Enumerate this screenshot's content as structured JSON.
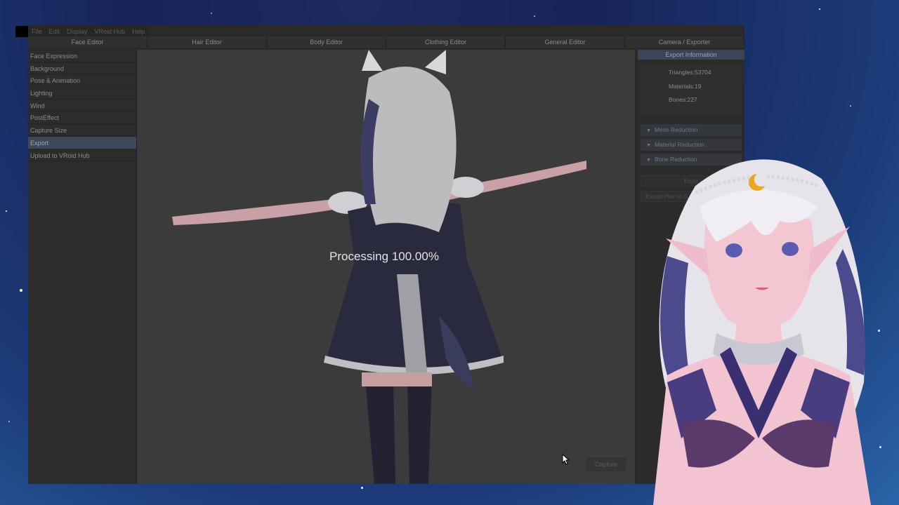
{
  "menu": [
    "File",
    "Edit",
    "Display",
    "VRoid Hub",
    "Help"
  ],
  "tabs": [
    "Face Editor",
    "Hair Editor",
    "Body Editor",
    "Clothing Editor",
    "General Editor",
    "Camera / Exporter"
  ],
  "sidebar": {
    "items": [
      {
        "label": "Face Expression"
      },
      {
        "label": "Background"
      },
      {
        "label": "Pose & Animation"
      },
      {
        "label": "Lighting"
      },
      {
        "label": "Wind"
      },
      {
        "label": "PostEffect"
      },
      {
        "label": "Capture Size"
      },
      {
        "label": "Export"
      },
      {
        "label": "Upload to VRoid Hub"
      }
    ],
    "active_label": "Export"
  },
  "viewport": {
    "processing_text": "Processing 100.00%",
    "capture_label": "Capture"
  },
  "export_panel": {
    "header": "Export Information",
    "triangles": "Triangles:53704",
    "materials": "Materials:19",
    "bones": "Bones:227",
    "sections": [
      "Mesh Reduction",
      "Material Reduction",
      "Bone Reduction"
    ],
    "export_button": "Expo",
    "export_hair_button": "Export Hair to G"
  },
  "colors": {
    "background_space": "#1c2f6a",
    "active_item": "#3e4a5c",
    "panel_header": "#3a4556"
  }
}
